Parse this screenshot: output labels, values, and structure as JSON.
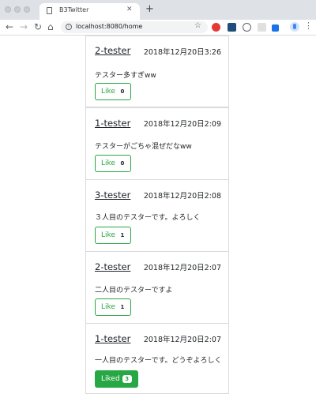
{
  "browser": {
    "tab_title": "B3Twitter",
    "url": "localhost:8080/home",
    "colors": {
      "accent": "#28a745"
    }
  },
  "posts": [
    {
      "user": "2-tester",
      "date": "2018年12月20日3:26",
      "text": "テスター多すぎww",
      "like_label": "Like",
      "likes": "0",
      "liked": false
    },
    {
      "user": "1-tester",
      "date": "2018年12月20日2:09",
      "text": "テスターがごちゃ混ぜだなww",
      "like_label": "Like",
      "likes": "0",
      "liked": false
    },
    {
      "user": "3-tester",
      "date": "2018年12月20日2:08",
      "text": "３人目のテスターです。よろしく",
      "like_label": "Like",
      "likes": "1",
      "liked": false
    },
    {
      "user": "2-tester",
      "date": "2018年12月20日2:07",
      "text": "二人目のテスターですよ",
      "like_label": "Like",
      "likes": "1",
      "liked": false
    },
    {
      "user": "1-tester",
      "date": "2018年12月20日2:07",
      "text": "一人目のテスターです。どうぞよろしく",
      "like_label": "Liked",
      "likes": "3",
      "liked": true
    }
  ]
}
